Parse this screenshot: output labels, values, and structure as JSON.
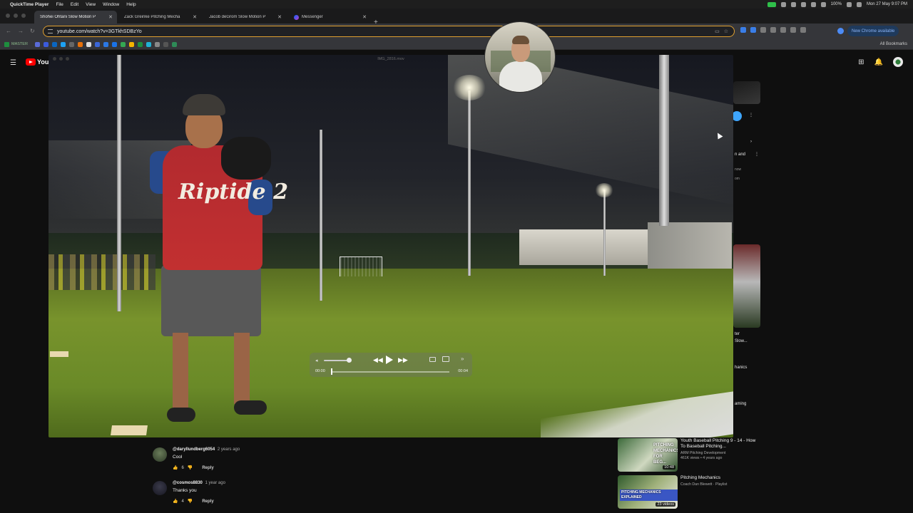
{
  "menubar": {
    "app": "QuickTime Player",
    "items": [
      "File",
      "Edit",
      "View",
      "Window",
      "Help"
    ],
    "battery": "100%",
    "datetime": "Mon 27 May  9:07 PM"
  },
  "tabs": [
    {
      "title": "Shohei Ohtani Slow Motion P",
      "favicon": "youtube",
      "active": true
    },
    {
      "title": "Zack Greinke Pitching Mecha",
      "favicon": "youtube",
      "active": false
    },
    {
      "title": "Jacob deGrom Slow Motion P",
      "favicon": "youtube",
      "active": false
    },
    {
      "title": "Messenger",
      "favicon": "messenger",
      "active": false
    }
  ],
  "address": {
    "url": "youtube.com/watch?v=3GTkhSDBzYo"
  },
  "toolbar": {
    "new_chrome": "New Chrome available"
  },
  "bookmarks": {
    "master": "MASTER",
    "all": "All Bookmarks"
  },
  "quicktime": {
    "filename": "IMG_2816.mov",
    "time_current": "00:00",
    "time_remaining": "00:04",
    "jersey_text": "Riptide 2"
  },
  "sidebar_fragments": {
    "f1": "n and",
    "f2": "now",
    "f3": "om",
    "f4": "ter",
    "f5": "Slow...",
    "f6": "hanics",
    "f7": "aming"
  },
  "recommendations": [
    {
      "thumb_text": "PITCHING MECHANICS FOR BEG...",
      "duration": "10:48",
      "title": "Youth Baseball Pitching 9 - 14 - How To Baseball Pitching...",
      "channel": "ARM Pitching Development",
      "stats": "461K views • 4 years ago"
    },
    {
      "thumb_text": "PITCHING MECHANICS EXPLAINED",
      "duration": "23 videos",
      "title": "Pitching Mechanics",
      "channel": "Coach Dan Blewett · Playlist",
      "stats": ""
    }
  ],
  "comments": [
    {
      "user": "@daryllundberg6054",
      "date": "2 years ago",
      "text": "Cool",
      "likes": "6",
      "reply": "Reply"
    },
    {
      "user": "@cosmos8830",
      "date": "1 year ago",
      "text": "Thanks you",
      "likes": "4",
      "reply": "Reply"
    }
  ],
  "colors": {
    "accent": "#ff0000",
    "omnibox_border": "#e0a030",
    "link": "#3ea6ff"
  }
}
